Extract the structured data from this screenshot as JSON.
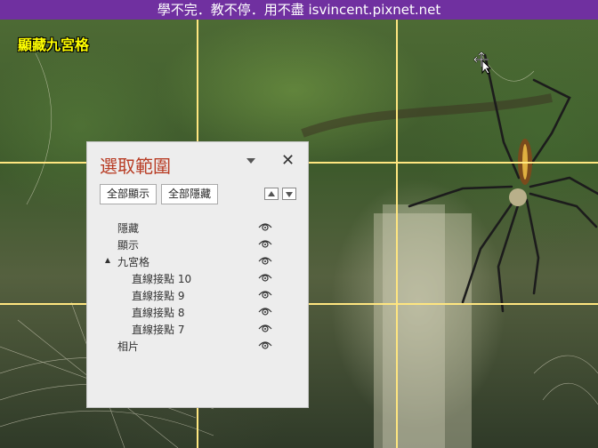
{
  "banner": {
    "text": "學不完．教不停．用不盡 isvincent.pixnet.net"
  },
  "overlay": {
    "label": "顯藏九宮格"
  },
  "pane": {
    "title": "選取範圍",
    "show_all": "全部顯示",
    "hide_all": "全部隱藏",
    "items": [
      {
        "label": "隱藏"
      },
      {
        "label": "顯示"
      },
      {
        "label": "九宮格"
      },
      {
        "label": "直線接點 10"
      },
      {
        "label": "直線接點 9"
      },
      {
        "label": "直線接點 8"
      },
      {
        "label": "直線接點 7"
      },
      {
        "label": "相片"
      }
    ]
  },
  "colors": {
    "banner": "#7030a0",
    "gridline": "#ffe680",
    "title": "#b83c24",
    "overlay_label": "#ffff00"
  }
}
